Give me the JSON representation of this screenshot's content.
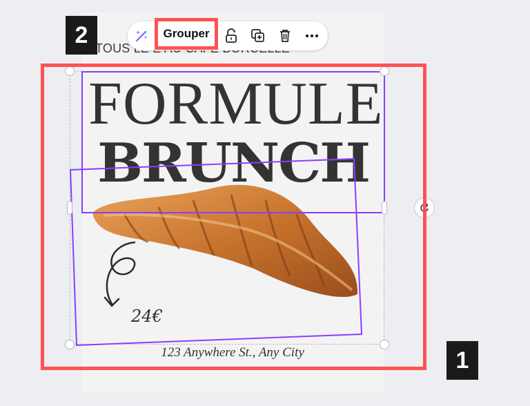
{
  "toolbar": {
    "magic_icon": "magic-wand-icon",
    "group_label": "Grouper",
    "lock_icon": "lock-icon",
    "duplicate_icon": "duplicate-icon",
    "delete_icon": "trash-icon",
    "more_icon": "more-icon"
  },
  "design": {
    "top_text": "TOUS LE         E AU CAFÉ BORCELLE",
    "title_line1": "FORMULE",
    "title_line2": "BRUNCH",
    "price": "24€",
    "address": "123 Anywhere St., Any City"
  },
  "annotations": {
    "badge_1": "1",
    "badge_2": "2"
  },
  "colors": {
    "selection_purple": "#8b3dff",
    "highlight_red": "#ff5252",
    "badge_bg": "#1a1a1a"
  }
}
